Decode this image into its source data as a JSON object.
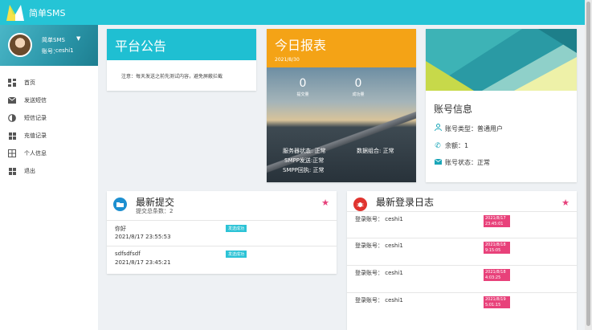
{
  "brand": {
    "name": "简单SMS"
  },
  "user": {
    "name": "简单SMS",
    "account_label": "账号：",
    "account": "ceshi1"
  },
  "sidebar": {
    "items": [
      {
        "label": "首页",
        "icon": "dashboard-icon"
      },
      {
        "label": "发送短信",
        "icon": "mail-icon"
      },
      {
        "label": "短信记录",
        "icon": "contrast-icon"
      },
      {
        "label": "充值记录",
        "icon": "apps-icon"
      },
      {
        "label": "个人信息",
        "icon": "table-icon"
      },
      {
        "label": "退出",
        "icon": "apps-icon"
      }
    ]
  },
  "announcement": {
    "title": "平台公告",
    "body": "注意：每天发送之前先测试内容，避免屏蔽拦截"
  },
  "report": {
    "title": "今日报表",
    "date": "2021/8/30",
    "submitted": {
      "value": "0",
      "label": "提交量"
    },
    "success": {
      "value": "0",
      "label": "成功量"
    },
    "server_status": "服务器状态: 正常",
    "smpp_send": "SMPP发送:正常",
    "smpp_receipt": "SMPP回执: 正常",
    "data_combo": "数据组合: 正常"
  },
  "account": {
    "title": "账号信息",
    "type": "账号类型：普通用户",
    "balance": "余额：1",
    "status": "账号状态：正常"
  },
  "latest_submissions": {
    "title": "最新提交",
    "subtitle": "提交总条数：2",
    "rows": [
      {
        "text": "你好",
        "time": "2021/8/17 23:55:53",
        "status": "发送成功"
      },
      {
        "text": "sdfsdfsdf",
        "time": "2021/8/17 23:45:21",
        "status": "发送成功"
      }
    ]
  },
  "latest_logins": {
    "title": "最新登录日志",
    "rows": [
      {
        "label": "登录账号：  ceshi1",
        "date": "2021/8/17",
        "time": "23:45:01"
      },
      {
        "label": "登录账号：  ceshi1",
        "date": "2021/8/18",
        "time": "9:15:05"
      },
      {
        "label": "登录账号：  ceshi1",
        "date": "2021/8/18",
        "time": "4:03:25"
      },
      {
        "label": "登录账号：  ceshi1",
        "date": "2021/8/19",
        "time": "5:01:15"
      }
    ]
  },
  "colors": {
    "primary": "#25c4d6",
    "orange": "#f4a316",
    "pink": "#e8417a"
  }
}
